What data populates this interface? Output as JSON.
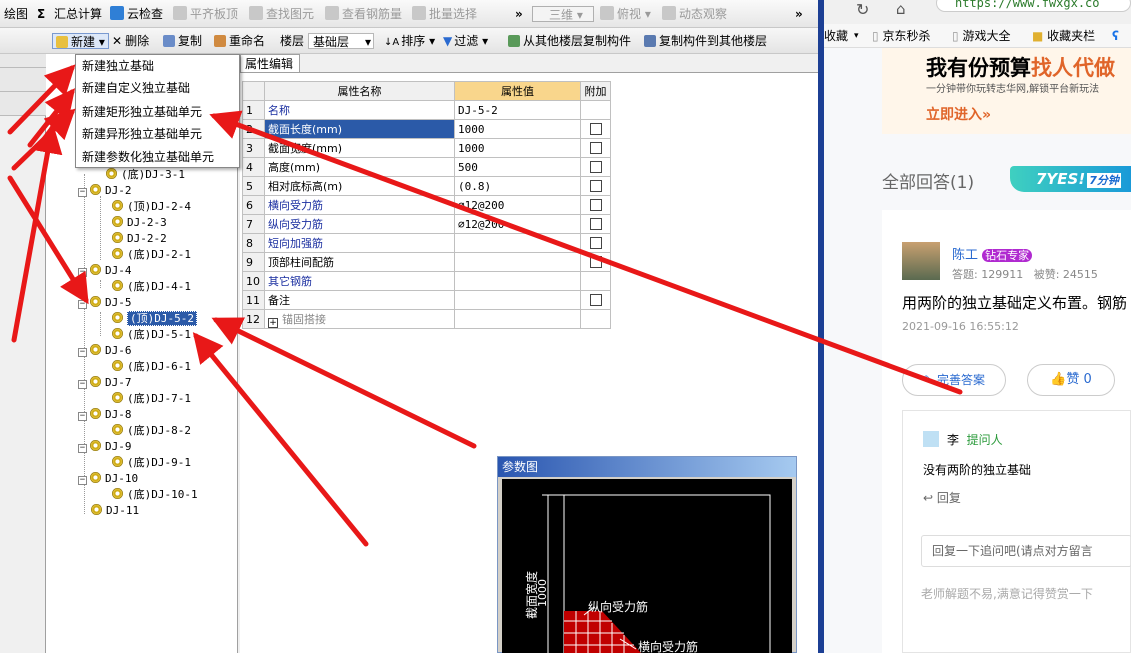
{
  "toolbar1": {
    "draw": "绘图",
    "sum_symbol": "Σ",
    "summary_calc": "汇总计算",
    "cloud_check": "云检查",
    "level_slab_top": "平齐板顶",
    "find_element": "查找图元",
    "view_rebar_qty": "查看钢筋量",
    "batch_select": "批量选择",
    "more": "»",
    "view_3d": "三维",
    "top_view": "俯视",
    "dynamic_view": "动态观察"
  },
  "toolbar2": {
    "new": "新建",
    "delete": "删除",
    "copy": "复制",
    "rename": "重命名",
    "floor_label": "楼层",
    "floor_value": "基础层",
    "sort": "排序",
    "filter": "过滤",
    "copy_from_floor": "从其他楼层复制构件",
    "copy_to_floor": "复制构件到其他楼层"
  },
  "dropdown_menu": {
    "items": [
      "新建独立基础",
      "新建自定义独立基础",
      "新建矩形独立基础单元",
      "新建异形独立基础单元",
      "新建参数化独立基础单元"
    ]
  },
  "tree": {
    "items": [
      {
        "label": "(底)DJ-3-1"
      },
      {
        "label": "DJ-2"
      },
      {
        "label": "(顶)DJ-2-4"
      },
      {
        "label": "DJ-2-3"
      },
      {
        "label": "DJ-2-2"
      },
      {
        "label": "(底)DJ-2-1"
      },
      {
        "label": "DJ-4"
      },
      {
        "label": "(底)DJ-4-1"
      },
      {
        "label": "DJ-5"
      },
      {
        "label": "(顶)DJ-5-2"
      },
      {
        "label": "(底)DJ-5-1"
      },
      {
        "label": "DJ-6"
      },
      {
        "label": "(底)DJ-6-1"
      },
      {
        "label": "DJ-7"
      },
      {
        "label": "(底)DJ-7-1"
      },
      {
        "label": "DJ-8"
      },
      {
        "label": "(底)DJ-8-2"
      },
      {
        "label": "DJ-9"
      },
      {
        "label": "(底)DJ-9-1"
      },
      {
        "label": "DJ-10"
      },
      {
        "label": "(底)DJ-10-1"
      },
      {
        "label": "DJ-11"
      }
    ]
  },
  "property_panel": {
    "tab": "属性编辑",
    "headers": {
      "name": "属性名称",
      "value": "属性值",
      "extra": "附加"
    },
    "rows": [
      {
        "num": "1",
        "name": "名称",
        "value": "DJ-5-2",
        "checkbox": false
      },
      {
        "num": "2",
        "name": "截面长度(mm)",
        "value": "1000",
        "checkbox": true
      },
      {
        "num": "3",
        "name": "截面宽度(mm)",
        "value": "1000",
        "checkbox": true
      },
      {
        "num": "4",
        "name": "高度(mm)",
        "value": "500",
        "checkbox": true
      },
      {
        "num": "5",
        "name": "相对底标高(m)",
        "value": "(0.8)",
        "checkbox": true
      },
      {
        "num": "6",
        "name": "横向受力筋",
        "value": "⌀12@200",
        "checkbox": true
      },
      {
        "num": "7",
        "name": "纵向受力筋",
        "value": "⌀12@200",
        "checkbox": true
      },
      {
        "num": "8",
        "name": "短向加强筋",
        "value": "",
        "checkbox": true
      },
      {
        "num": "9",
        "name": "顶部柱间配筋",
        "value": "",
        "checkbox": true
      },
      {
        "num": "10",
        "name": "其它钢筋",
        "value": "",
        "checkbox": false
      },
      {
        "num": "11",
        "name": "备注",
        "value": "",
        "checkbox": true
      },
      {
        "num": "12",
        "name": "锚固搭接",
        "value": "",
        "checkbox": false
      }
    ]
  },
  "reference_window": {
    "title": "参数图",
    "dim_label": "截面宽度",
    "dim_value": "1000",
    "longitudinal": "纵向受力筋",
    "transverse": "横向受力筋"
  },
  "browser": {
    "url": "https://www.fwxgx.co",
    "bookmarks": [
      "收藏",
      "京东秒杀",
      "游戏大全",
      "收藏夹栏"
    ],
    "ad": {
      "title_part1": "我有份预算",
      "title_part2": "找人代做",
      "subtitle": "一分钟带你玩转志华网,解锁平台新玩法",
      "cta": "立即进入»"
    },
    "answers_header": "全部回答(1)",
    "badge": "7YES!",
    "badge_sub": "7分钟",
    "answer": {
      "author": "陈工",
      "tag": "钻石专家",
      "answers_count": "答题: 129911",
      "praised": "被赞: 24515",
      "text": "用两阶的独立基础定义布置。钢筋",
      "time": "2021-09-16 16:55:12",
      "improve": "完善答案",
      "like": "赞 0"
    },
    "followup": {
      "author": "李",
      "role": "提问人",
      "text": "没有两阶的独立基础",
      "reply": "回复"
    },
    "reply_placeholder": "回复一下追问吧(请点对方留言",
    "footer_note": "老师解题不易,满意记得赞赏一下"
  }
}
